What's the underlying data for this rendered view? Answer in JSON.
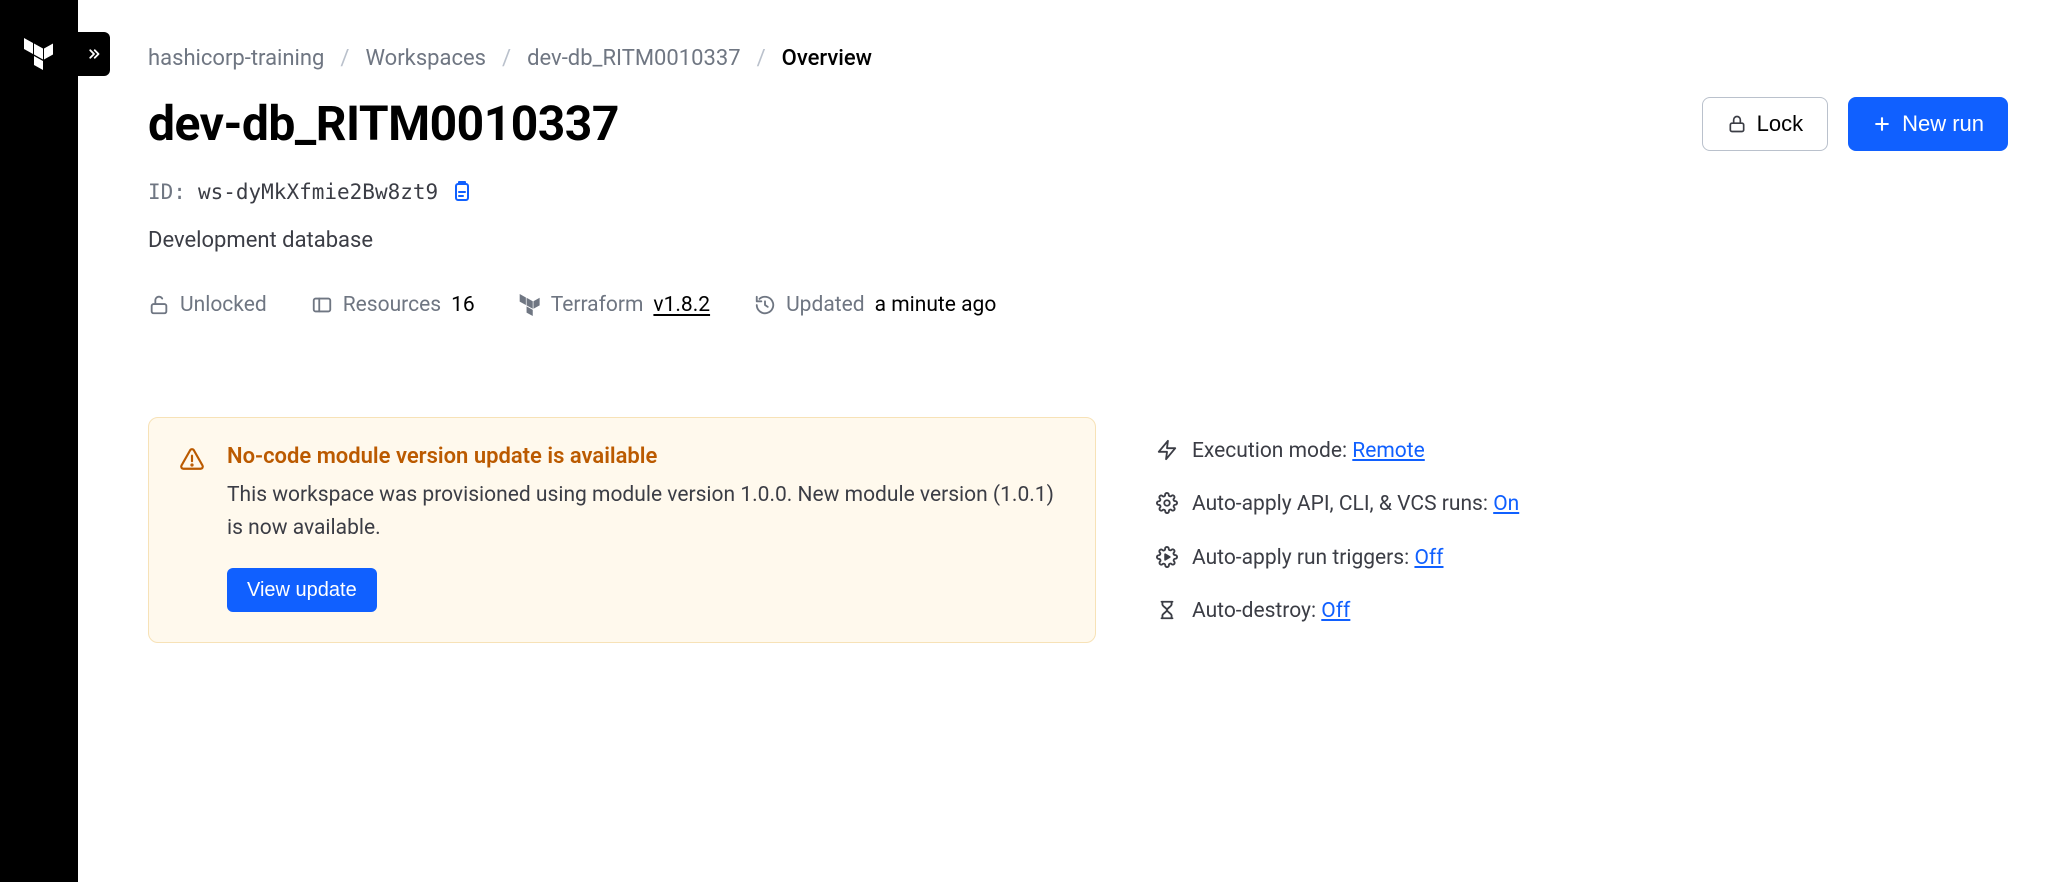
{
  "breadcrumb": {
    "org": "hashicorp-training",
    "workspaces": "Workspaces",
    "workspace": "dev-db_RITM0010337",
    "current": "Overview"
  },
  "page": {
    "title": "dev-db_RITM0010337",
    "id_label": "ID:",
    "id_value": "ws-dyMkXfmie2Bw8zt9",
    "description": "Development database"
  },
  "actions": {
    "lock": "Lock",
    "new_run": "New run"
  },
  "meta": {
    "lock_state": "Unlocked",
    "resources_label": "Resources",
    "resources_count": "16",
    "terraform_label": "Terraform",
    "terraform_version": "v1.8.2",
    "updated_label": "Updated",
    "updated_value": "a minute ago"
  },
  "alert": {
    "title": "No-code module version update is available",
    "body": "This workspace was provisioned using module version 1.0.0. New module version (1.0.1) is now available.",
    "button": "View update"
  },
  "settings": {
    "execution_mode_label": "Execution mode:",
    "execution_mode_value": "Remote",
    "auto_apply_api_label": "Auto-apply API, CLI, & VCS runs:",
    "auto_apply_api_value": "On",
    "auto_apply_triggers_label": "Auto-apply run triggers:",
    "auto_apply_triggers_value": "Off",
    "auto_destroy_label": "Auto-destroy:",
    "auto_destroy_value": "Off"
  }
}
